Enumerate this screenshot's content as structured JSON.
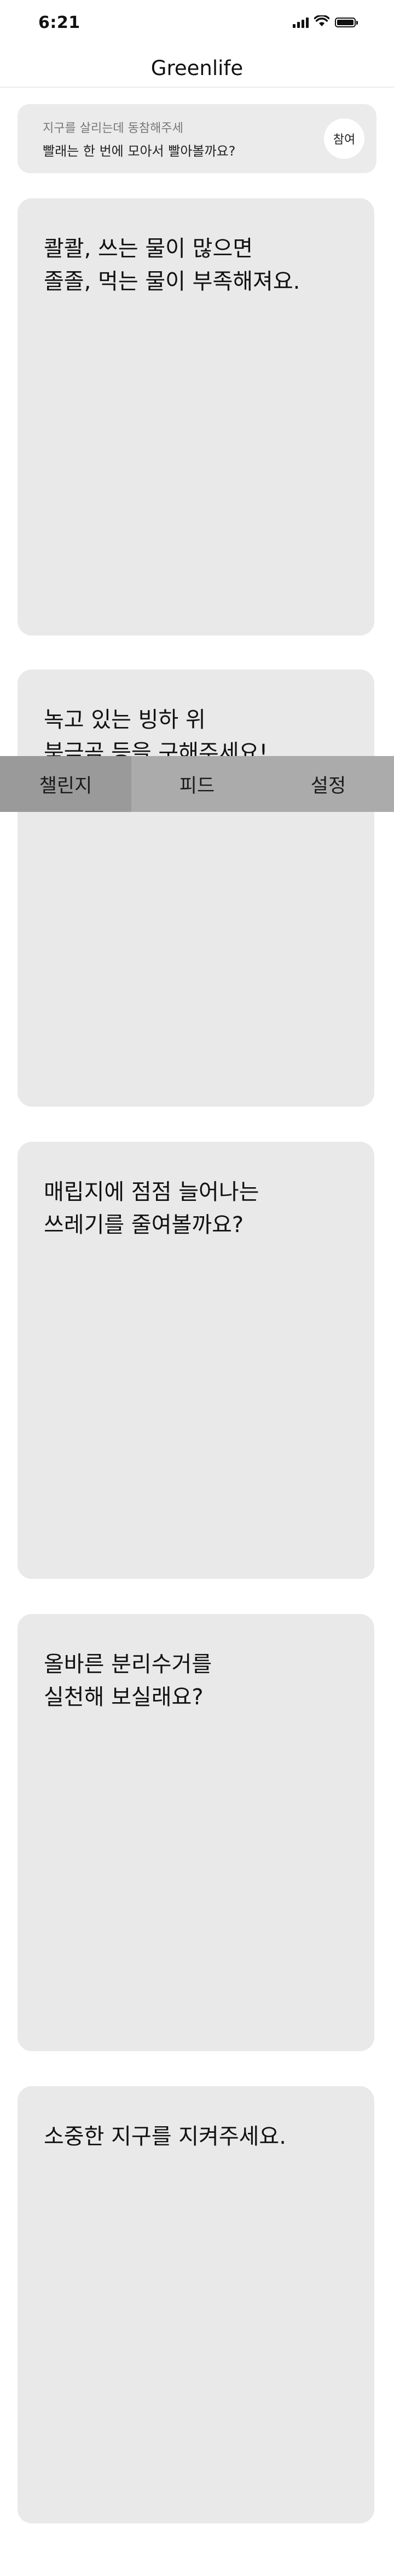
{
  "status_bar": {
    "time": "6:21",
    "icons": [
      "signal-icon",
      "wifi-icon",
      "battery-icon"
    ]
  },
  "header": {
    "title": "Greenlife"
  },
  "banner": {
    "subtitle": "지구를 살리는데 동참해주세",
    "message": "빨래는 한 번에 모아서 빨아볼까요?",
    "join_label": "참여"
  },
  "cards": [
    {
      "text": "콸콸, 쓰는 물이 많으면\n졸졸, 먹는 물이 부족해져요."
    },
    {
      "text": "녹고 있는 빙하 위\n북극곰 등을 구해주세요!"
    },
    {
      "text": "매립지에 점점 늘어나는\n쓰레기를 줄여볼까요?"
    },
    {
      "text": "올바른 분리수거를\n실천해 보실래요?"
    },
    {
      "text": "소중한 지구를 지켜주세요."
    }
  ],
  "tabs": [
    {
      "label": "챌린지",
      "active": true
    },
    {
      "label": "피드",
      "active": false
    },
    {
      "label": "설정",
      "active": false
    }
  ],
  "colors": {
    "card_background": "#e9e9e9",
    "tab_bar_background": "#ababab",
    "tab_active_background": "#9a9a9a"
  }
}
